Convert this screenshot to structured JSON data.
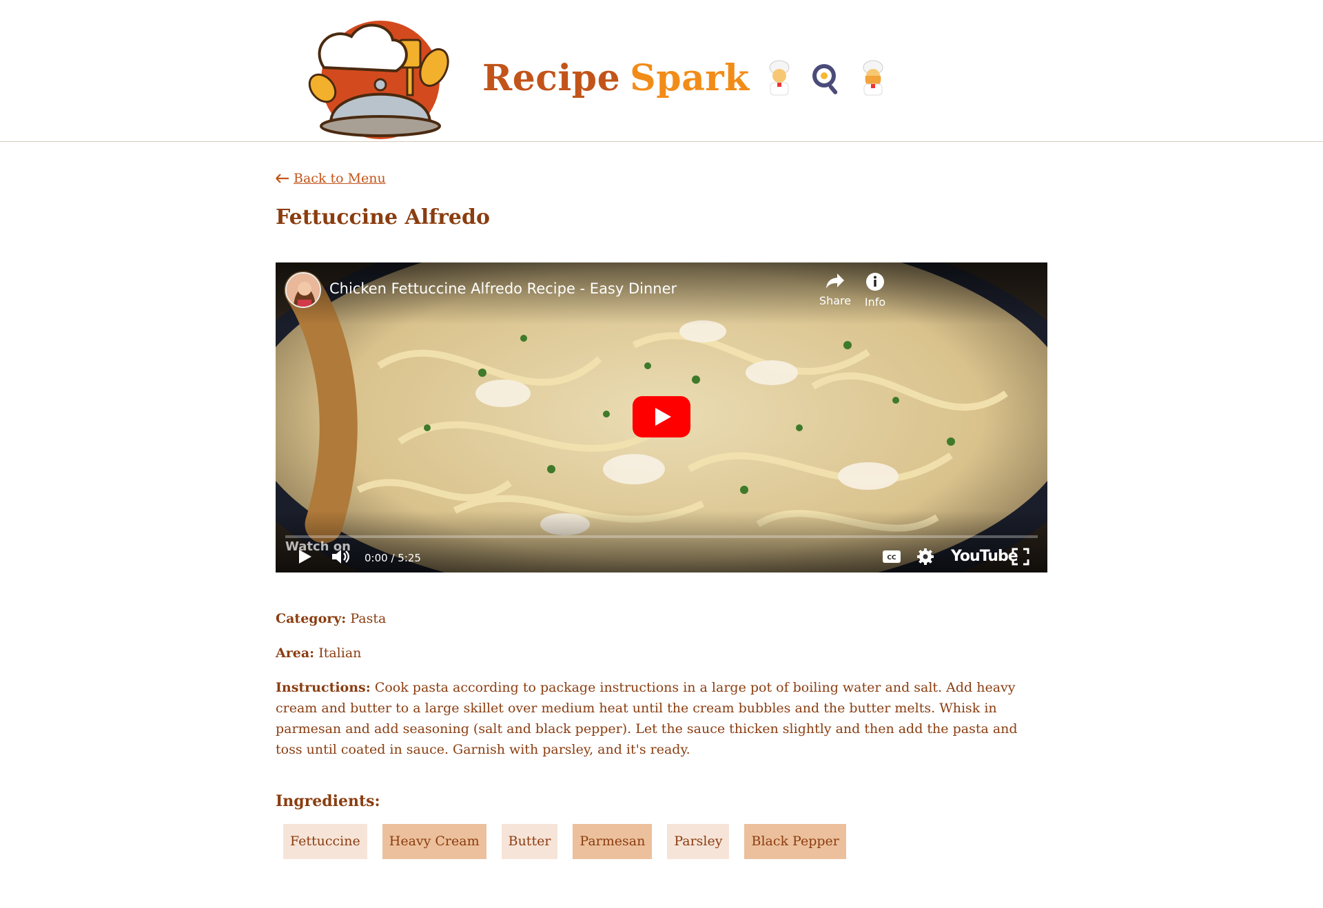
{
  "brand": {
    "word1": "Recipe",
    "word2": "Spark"
  },
  "nav": {
    "back_label": " Back to Menu"
  },
  "recipe": {
    "title": "Fettuccine Alfredo",
    "category_label": "Category:",
    "category": "Pasta",
    "area_label": "Area:",
    "area": "Italian",
    "instructions_label": "Instructions:",
    "instructions": "Cook pasta according to package instructions in a large pot of boiling water and salt. Add heavy cream and butter to a large skillet over medium heat until the cream bubbles and the butter melts. Whisk in parmesan and add seasoning (salt and black pepper). Let the sauce thicken slightly and then add the pasta and toss until coated in sauce. Garnish with parsley, and it's ready."
  },
  "video": {
    "title": "Chicken Fettuccine Alfredo Recipe - Easy Dinner",
    "share_label": "Share",
    "info_label": "Info",
    "watch_on_label": "Watch on",
    "time": "0:00 / 5:25",
    "youtube_label": "YouTube",
    "progress": 0
  },
  "ingredients": {
    "heading": "Ingredients:",
    "items": [
      "Fettuccine",
      "Heavy Cream",
      "Butter",
      "Parmesan",
      "Parsley",
      "Black Pepper"
    ]
  },
  "colors": {
    "accent": "#c2541a",
    "accent_light": "#f28c18",
    "text": "#8a3d10",
    "chip_light": "#f7e4d8",
    "chip_dark": "#ecc09c"
  },
  "icons": [
    "chef-logo-icon",
    "male-cook-icon",
    "frying-pan-icon",
    "female-cook-icon",
    "arrow-left-icon",
    "share-icon",
    "info-icon",
    "play-icon",
    "volume-icon",
    "captions-icon",
    "settings-icon",
    "fullscreen-icon"
  ]
}
